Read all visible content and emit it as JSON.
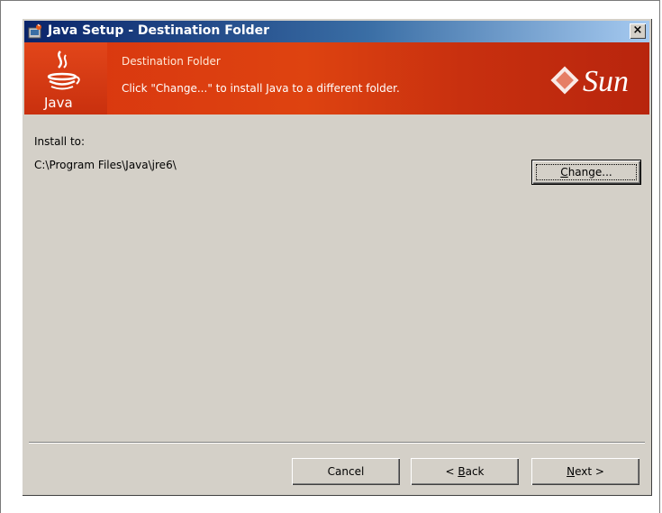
{
  "window": {
    "title": "Java Setup - Destination Folder",
    "close_glyph": "×"
  },
  "banner": {
    "title": "Destination Folder",
    "subtitle": "Click \"Change...\" to install Java to a different folder.",
    "java_logo_text": "Java",
    "sun_logo_text": "Sun",
    "colors": {
      "banner": "#d8350f",
      "title_bar": "#0a246a"
    }
  },
  "content": {
    "install_label": "Install to:",
    "install_path": "C:\\Program Files\\Java\\jre6\\"
  },
  "buttons": {
    "change_prefix": "",
    "change_mnemonic": "C",
    "change_rest": "hange...",
    "cancel": "Cancel",
    "back_prefix": "< ",
    "back_mnemonic": "B",
    "back_rest": "ack",
    "next_mnemonic": "N",
    "next_rest": "ext >"
  },
  "icons": {
    "title_icon": "java-setup-icon",
    "java_logo": "java-coffee-cup-icon",
    "sun_logo": "sun-microsystems-logo"
  }
}
